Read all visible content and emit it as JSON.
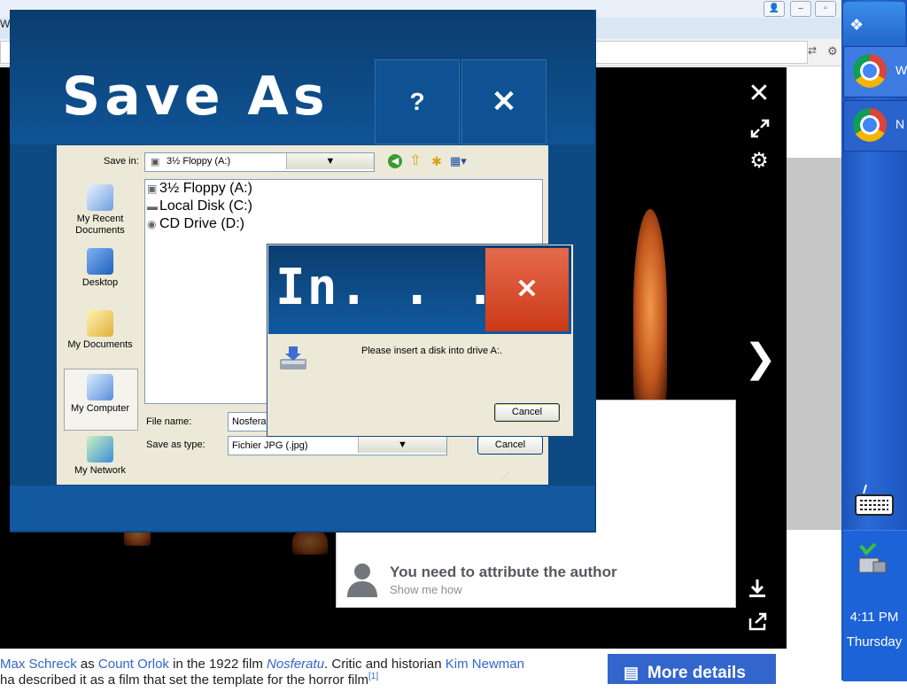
{
  "browser": {
    "tiny_title_fragment": "W"
  },
  "lightbox": {
    "attribution_title": "You need to attribute the author",
    "attribution_sub": "Show me how",
    "more_details_label": "More details",
    "caption_line1": [
      {
        "text": "Max Schreck",
        "link": true
      },
      {
        "text": " as ",
        "link": false
      },
      {
        "text": "Count Orlok",
        "link": true
      },
      {
        "text": " in the 1922 film ",
        "link": false
      },
      {
        "text": "Nosferatu",
        "link": true,
        "italic": true
      },
      {
        "text": ". Critic and historian ",
        "link": false
      },
      {
        "text": "Kim Newman",
        "link": true
      }
    ],
    "caption_line2": "ha described it as a film that set the template for the horror film",
    "footnote": "[1]"
  },
  "save_dialog": {
    "title": "Save As",
    "help_label": "?",
    "close_label": "✕",
    "save_in_label": "Save in:",
    "save_in_value": "3½ Floppy (A:)",
    "places": [
      {
        "label": "My Recent Documents"
      },
      {
        "label": "Desktop"
      },
      {
        "label": "My Documents"
      },
      {
        "label": "My Computer"
      },
      {
        "label": "My Network"
      }
    ],
    "files": [
      {
        "name": "3½ Floppy (A:)",
        "icon": "floppy-drive-icon"
      },
      {
        "name": "Local Disk (C:)",
        "icon": "hard-disk-icon"
      },
      {
        "name": "CD Drive (D:)",
        "icon": "cd-drive-icon"
      }
    ],
    "file_name_label": "File name:",
    "file_name_value": "Nosferatu",
    "save_as_type_label": "Save as type:",
    "save_as_type_value": "Fichier JPG (.jpg)",
    "cancel_label": "Cancel"
  },
  "insert_dialog": {
    "title": "In. . .",
    "close_label": "✕",
    "message": "Please insert a disk into drive A:.",
    "cancel_label": "Cancel"
  },
  "taskbar": {
    "task1_label": "W",
    "task2_label": "N",
    "time": "4:11 PM",
    "day": "Thursday"
  },
  "colors": {
    "metro_blue": "#0d4a84",
    "close_red": "#d8472a",
    "link_blue": "#3366cc",
    "taskbar_blue": "#2a6ad6"
  }
}
